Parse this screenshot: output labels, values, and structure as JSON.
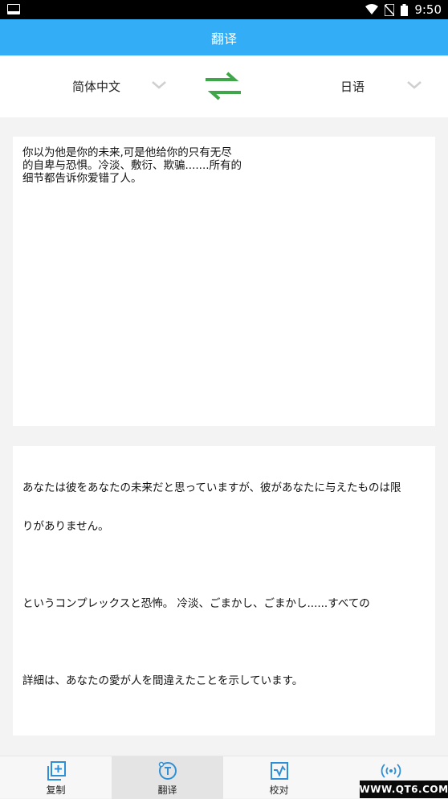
{
  "status_bar": {
    "time": "9:50"
  },
  "app_bar": {
    "title": "翻译"
  },
  "languages": {
    "source": "简体中文",
    "target": "日语",
    "source_chevron_icon": "chevron-down-icon",
    "target_chevron_icon": "chevron-down-icon",
    "swap_icon": "swap-arrows-icon",
    "swap_color": "#3fa64a"
  },
  "source_text": "你以为他是你的未来,可是他给你的只有无尽\n的自卑与恐惧。冷淡、敷衍、欺骗.......所有的\n细节都告诉你爱错了人。",
  "translation_lines": [
    "あなたは彼をあなたの未来だと思っていますが、彼があなたに与えたものは限",
    "りがありません。",
    "",
    "というコンプレックスと恐怖。 冷淡、ごまかし、ごまかし......すべての",
    "",
    "詳細は、あなたの愛が人を間違えたことを示しています。"
  ],
  "tabs": [
    {
      "label": "复制",
      "icon": "copy-icon"
    },
    {
      "label": "翻译",
      "icon": "translate-icon",
      "active": true
    },
    {
      "label": "校对",
      "icon": "proofread-icon"
    },
    {
      "label": "",
      "icon": "voice-broadcast-icon"
    }
  ],
  "watermark": "WWW.QT6.COM",
  "colors": {
    "accent": "#33adf6",
    "tab_icon": "#2f8fd6"
  }
}
